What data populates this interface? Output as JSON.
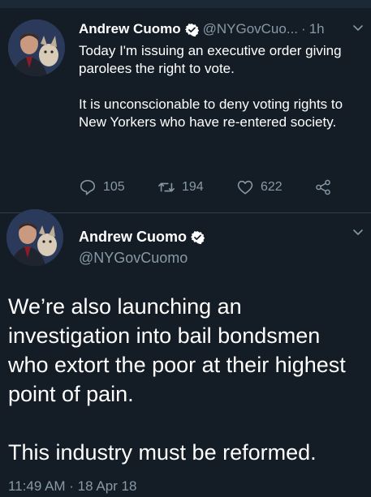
{
  "tweets": [
    {
      "author_name": "Andrew Cuomo",
      "handle": "@NYGovCuo...",
      "separator": "·",
      "time": "1h",
      "paragraphs": [
        "Today I'm issuing an executive order giving parolees the right to vote.",
        "It is unconscionable to deny voting rights to New Yorkers who have re-entered society."
      ],
      "stats": {
        "replies": "105",
        "retweets": "194",
        "likes": "622"
      }
    },
    {
      "author_name": "Andrew Cuomo",
      "handle": "@NYGovCuomo",
      "paragraphs": [
        "We’re also launching an investigation into bail bondsmen who extort the poor at their highest point of pain.",
        "This industry must be reformed."
      ],
      "timestamp": "11:49 AM · 18 Apr 18"
    }
  ],
  "icons": {
    "verified": "verified-badge-icon",
    "chevron": "chevron-down-icon",
    "reply": "reply-icon",
    "retweet": "retweet-icon",
    "like": "heart-icon",
    "share": "share-icon"
  },
  "colors": {
    "background": "#141d26",
    "secondary_text": "#8899a6",
    "primary_text": "#ffffff"
  }
}
